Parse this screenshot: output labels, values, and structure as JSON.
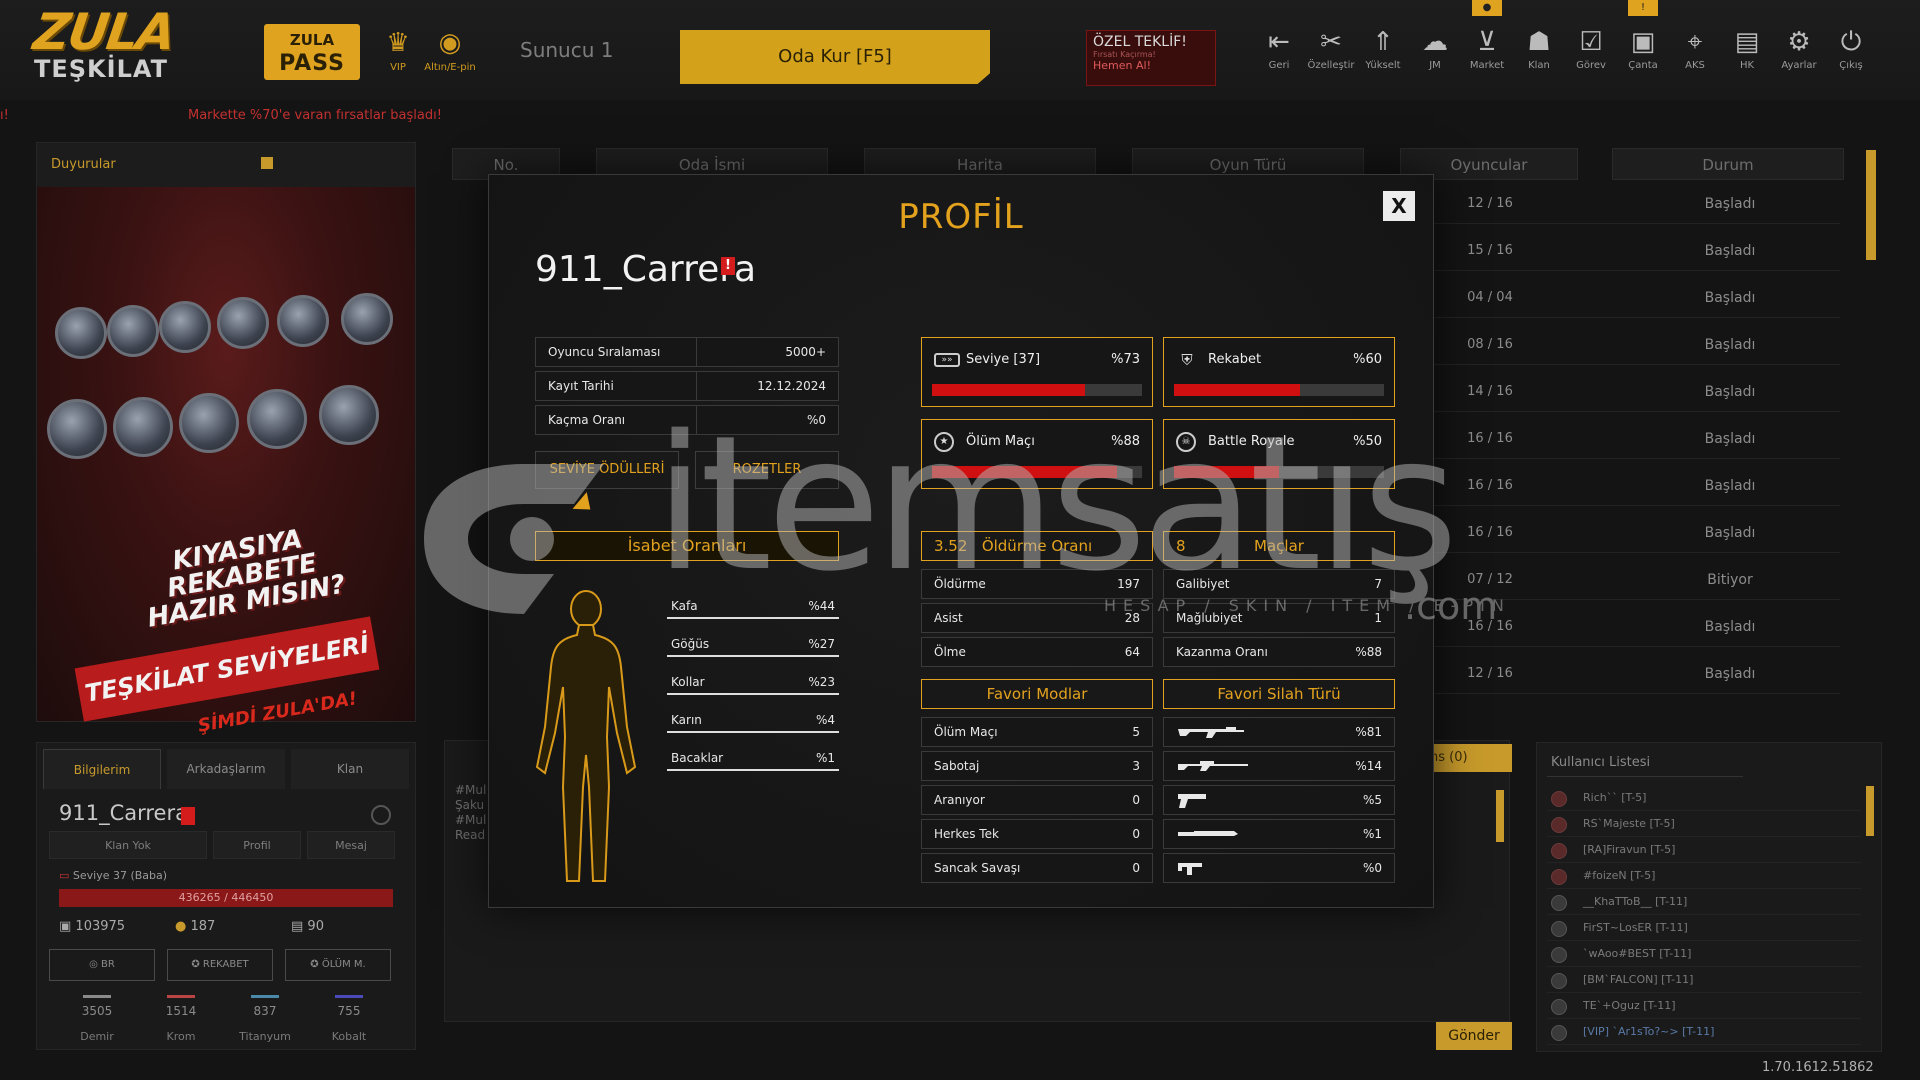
{
  "topbar": {
    "logo_line1": "ZULA",
    "logo_line2": "TEŞKİLAT",
    "pass_line1": "ZULA",
    "pass_line2": "PASS",
    "vip_label": "VIP",
    "gold_label": "Altın/E-pin",
    "server": "Sunucu 1",
    "create_room": "Oda Kur [F5]",
    "offer_title": "ÖZEL TEKLİF!",
    "offer_sub": "Fırsatı Kaçırma!",
    "offer_cta": "Hemen Al!",
    "nav": [
      {
        "label": "Geri",
        "icon": "back-icon"
      },
      {
        "label": "Özelleştir",
        "icon": "tools-icon"
      },
      {
        "label": "Yükselt",
        "icon": "upgrade-icon"
      },
      {
        "label": "JM",
        "icon": "jm-icon"
      },
      {
        "label": "Market",
        "icon": "cart-icon"
      },
      {
        "label": "Klan",
        "icon": "clan-icon"
      },
      {
        "label": "Görev",
        "icon": "task-icon"
      },
      {
        "label": "Çanta",
        "icon": "bag-icon"
      },
      {
        "label": "AKS",
        "icon": "aks-icon"
      },
      {
        "label": "HK",
        "icon": "hk-icon"
      },
      {
        "label": "Ayarlar",
        "icon": "gear-icon"
      },
      {
        "label": "Çıkış",
        "icon": "power-icon"
      }
    ],
    "ticker_left": "ı!",
    "ticker": "Markette %70'e varan fırsatlar başladı!"
  },
  "announcements": {
    "title": "Duyurular",
    "promo_line1": "KIYASIYA REKABETE",
    "promo_line2": "HAZIR MISIN?",
    "promo_line3": "TEŞKİLAT SEVİYELERİ",
    "promo_line4": "ŞİMDİ ZULA'DA!"
  },
  "mini_profile": {
    "tabs": [
      "Bilgilerim",
      "Arkadaşlarım",
      "Klan"
    ],
    "name": "911_Carrera",
    "buttons": [
      "Klan Yok",
      "Profil",
      "Mesaj"
    ],
    "level": "Seviye 37 (Baba)",
    "xp": "436265 / 446450",
    "currency1": "103975",
    "currency2": "187",
    "currency3": "90",
    "modes": [
      "BR",
      "REKABET",
      "ÖLÜM M."
    ],
    "resources": [
      {
        "value": "3505",
        "name": "Demir",
        "color": "#8a8a8a"
      },
      {
        "value": "1514",
        "name": "Krom",
        "color": "#b84444"
      },
      {
        "value": "837",
        "name": "Titanyum",
        "color": "#4a8aa8"
      },
      {
        "value": "755",
        "name": "Kobalt",
        "color": "#4a4ab8"
      }
    ]
  },
  "room_list": {
    "columns": [
      "No.",
      "Oda İsmi",
      "Harita",
      "Oyun Türü",
      "Oyuncular",
      "Durum"
    ],
    "rows": [
      {
        "players": "12 / 16",
        "status": "Başladı"
      },
      {
        "players": "15 / 16",
        "status": "Başladı"
      },
      {
        "players": "04 / 04",
        "status": "Başladı"
      },
      {
        "players": "08 / 16",
        "status": "Başladı"
      },
      {
        "players": "14 / 16",
        "status": "Başladı"
      },
      {
        "players": "16 / 16",
        "status": "Başladı"
      },
      {
        "players": "16 / 16",
        "status": "Başladı"
      },
      {
        "players": "16 / 16",
        "status": "Başladı"
      },
      {
        "players": "07 / 12",
        "status": "Bitiyor"
      },
      {
        "players": "16 / 16",
        "status": "Başladı"
      },
      {
        "players": "12 / 16",
        "status": "Başladı"
      }
    ]
  },
  "chat": {
    "fans_tab": "ns (0)",
    "lines": [
      "#Mul",
      "Şaku",
      "#Mul",
      "Read"
    ],
    "send": "Gönder"
  },
  "user_list": {
    "title": "Kullanıcı Listesi",
    "users": [
      "Rich`` [T-5]",
      "RS`Majeste [T-5]",
      "[RA]Firavun [T-5]",
      "#foizeN [T-5]",
      "__KhaTToB__ [T-11]",
      "FirST~LosER [T-11]",
      "`wAoo#BEST [T-11]",
      "[BM`FALCON] [T-11]",
      "TE`+Oguz [T-11]",
      "[VIP] `Ar1sTo?~> [T-11]"
    ]
  },
  "version": "1.70.1612.51862",
  "modal": {
    "title": "PROFİL",
    "close": "X",
    "name": "911_Carrera",
    "warn": "!",
    "info": [
      {
        "k": "Oyuncu Sıralaması",
        "v": "5000+"
      },
      {
        "k": "Kayıt Tarihi",
        "v": "12.12.2024"
      },
      {
        "k": "Kaçma Oranı",
        "v": "%0"
      }
    ],
    "btn_rewards": "SEVİYE ÖDÜLLERİ",
    "btn_badges": "ROZETLER",
    "hit_title": "İsabet Oranları",
    "hits": [
      {
        "k": "Kafa",
        "v": "%44"
      },
      {
        "k": "Göğüs",
        "v": "%27"
      },
      {
        "k": "Kollar",
        "v": "%23"
      },
      {
        "k": "Karın",
        "v": "%4"
      },
      {
        "k": "Bacaklar",
        "v": "%1"
      }
    ],
    "cards": [
      {
        "label": "Seviye [37]",
        "pct": "%73",
        "value": 0.73
      },
      {
        "label": "Rekabet",
        "pct": "%60",
        "value": 0.6
      },
      {
        "label": "Ölüm Maçı",
        "pct": "%88",
        "value": 0.88
      },
      {
        "label": "Battle Royale",
        "pct": "%50",
        "value": 0.5
      }
    ],
    "kd_value": "3.52",
    "kd_title": "Öldürme Oranı",
    "match_value": "8",
    "match_title": "Maçlar",
    "kills": [
      {
        "k": "Öldürme",
        "v": "197"
      },
      {
        "k": "Asist",
        "v": "28"
      },
      {
        "k": "Ölme",
        "v": "64"
      }
    ],
    "matches": [
      {
        "k": "Galibiyet",
        "v": "7"
      },
      {
        "k": "Mağlubiyet",
        "v": "1"
      },
      {
        "k": "Kazanma Oranı",
        "v": "%88"
      }
    ],
    "fav_modes_title": "Favori Modlar",
    "fav_modes": [
      {
        "k": "Ölüm Maçı",
        "v": "5"
      },
      {
        "k": "Sabotaj",
        "v": "3"
      },
      {
        "k": "Aranıyor",
        "v": "0"
      },
      {
        "k": "Herkes Tek",
        "v": "0"
      },
      {
        "k": "Sancak Savaşı",
        "v": "0"
      }
    ],
    "fav_weapons_title": "Favori Silah Türü",
    "fav_weapons": [
      {
        "icon": "rifle-icon",
        "v": "%81"
      },
      {
        "icon": "sniper-icon",
        "v": "%14"
      },
      {
        "icon": "pistol-icon",
        "v": "%5"
      },
      {
        "icon": "knife-icon",
        "v": "%1"
      },
      {
        "icon": "smg-icon",
        "v": "%0"
      }
    ]
  },
  "watermark": {
    "main": "itemsatış",
    "sub": "HESAP / SKIN / ITEM / E-PIN",
    "com": ".com"
  }
}
